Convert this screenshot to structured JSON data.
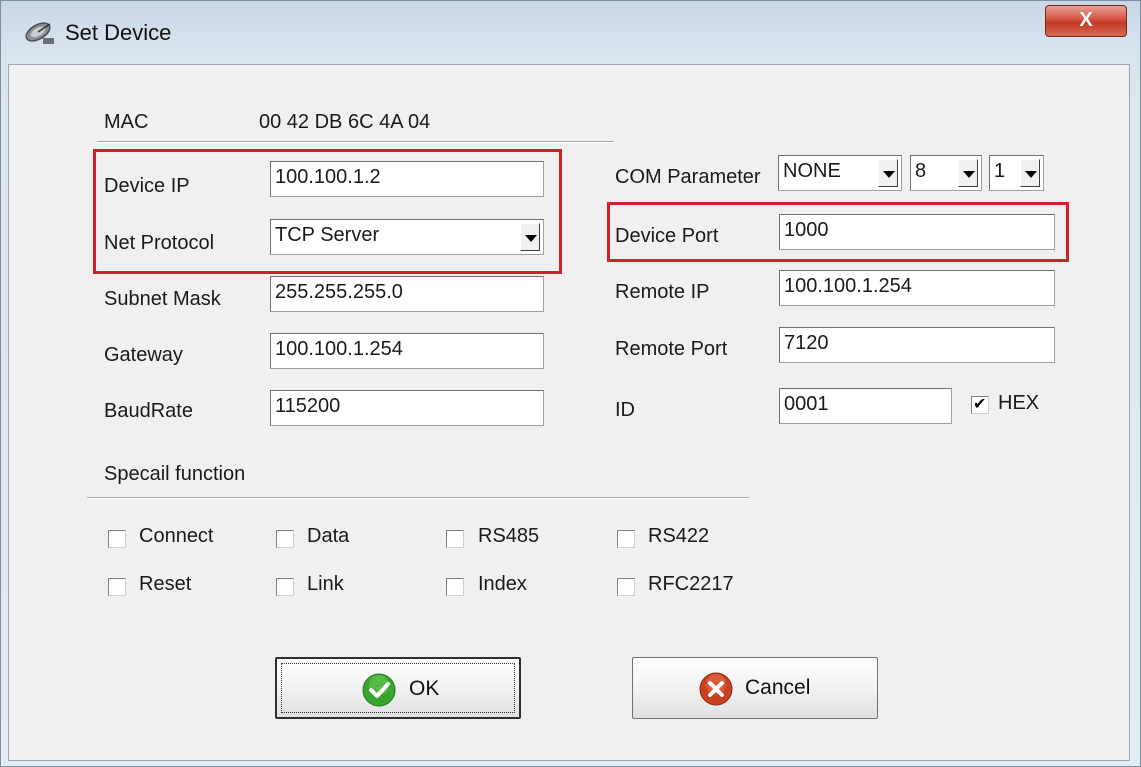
{
  "window": {
    "title": "Set Device",
    "close_label": "X"
  },
  "device_info": {
    "mac_label": "MAC",
    "mac_value": "00 42 DB 6C 4A 04"
  },
  "left_fields": {
    "device_ip": {
      "label": "Device IP",
      "value": "100.100.1.2"
    },
    "net_protocol": {
      "label": "Net Protocol",
      "value": "TCP Server"
    },
    "subnet_mask": {
      "label": "Subnet Mask",
      "value": "255.255.255.0"
    },
    "gateway": {
      "label": "Gateway",
      "value": "100.100.1.254"
    },
    "baudrate": {
      "label": "BaudRate",
      "value": "115200"
    }
  },
  "right_fields": {
    "com_parameter": {
      "label": "COM Parameter",
      "parity": "NONE",
      "data_bits": "8",
      "stop_bits": "1"
    },
    "device_port": {
      "label": "Device Port",
      "value": "1000"
    },
    "remote_ip": {
      "label": "Remote IP",
      "value": "100.100.1.254"
    },
    "remote_port": {
      "label": "Remote Port",
      "value": "7120"
    },
    "id": {
      "label": "ID",
      "value": "0001"
    },
    "hex": {
      "label": "HEX",
      "checked": true
    }
  },
  "special": {
    "heading": "Specail function",
    "options": [
      {
        "label": "Connect",
        "checked": false
      },
      {
        "label": "Data",
        "checked": false
      },
      {
        "label": "RS485",
        "checked": false
      },
      {
        "label": "RS422",
        "checked": false
      },
      {
        "label": "Reset",
        "checked": false
      },
      {
        "label": "Link",
        "checked": false
      },
      {
        "label": "Index",
        "checked": false
      },
      {
        "label": "RFC2217",
        "checked": false
      }
    ]
  },
  "buttons": {
    "ok": "OK",
    "cancel": "Cancel"
  },
  "colors": {
    "highlight_box": "#d0202c",
    "ok_icon": "#3aa52e",
    "cancel_icon": "#c8401f"
  },
  "icons": {
    "title": "satellite-dish-icon",
    "ok": "check-circle-icon",
    "cancel": "x-circle-icon"
  }
}
